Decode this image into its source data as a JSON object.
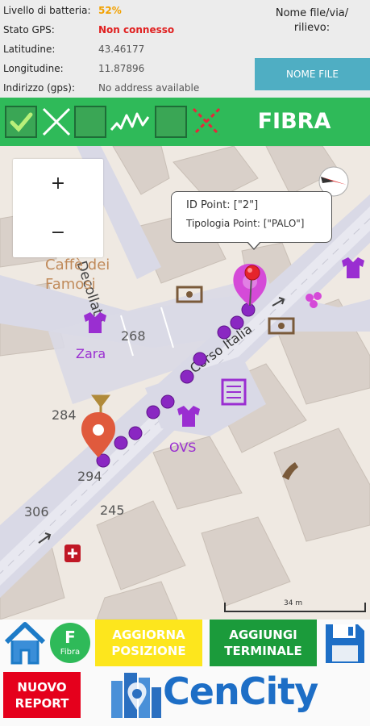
{
  "info": {
    "battery_label": "Livello di batteria:",
    "battery_value": "52%",
    "gps_label": "Stato GPS:",
    "gps_value": "Non connesso",
    "lat_label": "Latitudine:",
    "lat_value": "43.46177",
    "lon_label": "Longitudine:",
    "lon_value": "11.87896",
    "addr_label": "Indirizzo (gps):",
    "addr_value": "No address available",
    "file_label": "Nome file/via/\nrilievo:",
    "file_button": "NOME FILE"
  },
  "toolbar": {
    "title": "FIBRA",
    "tools": [
      "check-box-icon",
      "x-cross-icon",
      "empty-box-icon",
      "line-trace-icon",
      "empty-box-icon",
      "dashed-x-icon"
    ]
  },
  "map": {
    "zoom_in": "+",
    "zoom_out": "−",
    "popup": {
      "line1": "ID Point: [\"2\"]",
      "line2": "Tipologia Point: [\"PALO\"]"
    },
    "labels": {
      "street_decollato": "Via del Decollato",
      "street_corso": "Corso Italia",
      "cafe": "Caffè dei\nFamosi",
      "zara": "Zara",
      "ovs": "OVS",
      "n268": "268",
      "n284": "284",
      "n294": "294",
      "n306": "306",
      "n245": "245"
    },
    "scale": "34 m",
    "colors": {
      "road": "#d9d9e6",
      "building": "#d9d0c9",
      "purple": "#9a2ed1",
      "pin_red": "#e05a3d",
      "pin_pink": "#d54ad8"
    }
  },
  "bottom": {
    "fibro_letter": "F",
    "fibro_word": "Fibra",
    "aggiorna": "AGGIORNA\nPOSIZIONE",
    "terminale": "AGGIUNGI\nTERMINALE",
    "report": "NUOVO\nREPORT",
    "logo": "CenCity"
  }
}
